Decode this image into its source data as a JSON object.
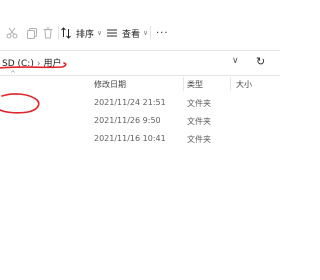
{
  "toolbar": {
    "icons": [
      "cut-icon",
      "copy-icon",
      "delete-icon"
    ],
    "sort_label": "排序",
    "view_label": "查看",
    "more_label": "···"
  },
  "address": {
    "crumbs": [
      "SD (C:)",
      "用户"
    ],
    "separator": "›",
    "dropdown_icon": "chevron-down-icon",
    "refresh_icon": "refresh-icon"
  },
  "columns": {
    "sort_caret": "^",
    "modified": "修改日期",
    "type": "类型",
    "size": "大小"
  },
  "rows": [
    {
      "date": "2021/11/24 21:51",
      "type": "文件夹"
    },
    {
      "date": "2021/11/26 9:50",
      "type": "文件夹"
    },
    {
      "date": "2021/11/16 10:41",
      "type": "文件夹"
    }
  ],
  "annotation": {
    "color": "#e0242b"
  }
}
